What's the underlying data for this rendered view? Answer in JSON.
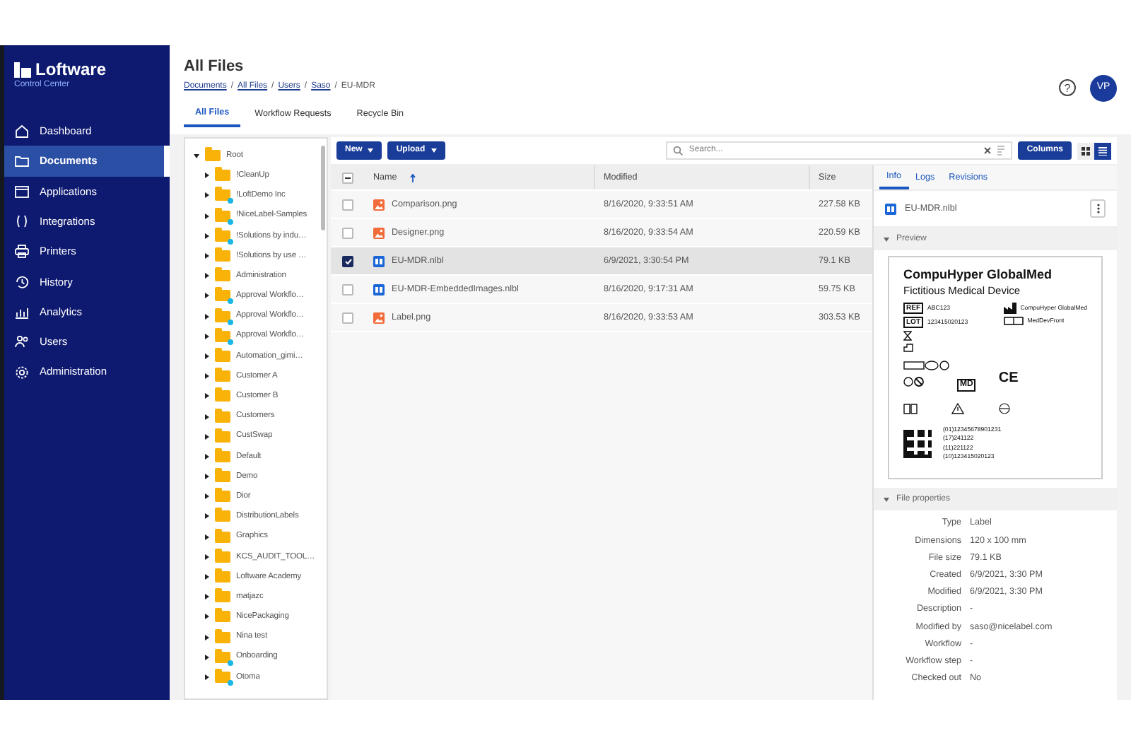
{
  "sidebar": {
    "logo": {
      "name": "Loftware",
      "subtitle": "Control Center"
    },
    "items": [
      {
        "label": "Dashboard",
        "selected": false
      },
      {
        "label": "Documents",
        "selected": true
      },
      {
        "label": "Applications",
        "selected": false
      },
      {
        "label": "Integrations",
        "selected": false
      },
      {
        "label": "Printers",
        "selected": false
      },
      {
        "label": "History",
        "selected": false
      },
      {
        "label": "Analytics",
        "selected": false
      },
      {
        "label": "Users",
        "selected": false
      },
      {
        "label": "Administration",
        "selected": false
      }
    ]
  },
  "header": {
    "title": "All Files",
    "breadcrumb": [
      {
        "label": "Documents",
        "current": false
      },
      {
        "label": "All Files",
        "current": false
      },
      {
        "label": "Users",
        "current": false
      },
      {
        "label": "Saso",
        "current": false
      },
      {
        "label": "EU-MDR",
        "current": true
      }
    ],
    "breadcrumb_separators": [
      "/",
      "/",
      "/",
      "/"
    ],
    "tabs": [
      {
        "label": "All Files",
        "selected": true
      },
      {
        "label": "Workflow Requests",
        "selected": false
      },
      {
        "label": "Recycle Bin",
        "selected": false
      }
    ],
    "help": "?",
    "avatar": "VP"
  },
  "tree": {
    "label": "Root",
    "expanded": true,
    "shared": false,
    "children": [
      {
        "label": "!CleanUp",
        "expanded": false,
        "shared": false
      },
      {
        "label": "!LoftDemo Inc",
        "expanded": false,
        "shared": true
      },
      {
        "label": "!NiceLabel-Samples",
        "expanded": false,
        "shared": true
      },
      {
        "label": "!Solutions by indu…",
        "expanded": false,
        "shared": true
      },
      {
        "label": "!Solutions by use …",
        "expanded": false,
        "shared": false
      },
      {
        "label": "Administration",
        "expanded": false,
        "shared": false
      },
      {
        "label": "Approval Workflo…",
        "expanded": false,
        "shared": true
      },
      {
        "label": "Approval Workflo…",
        "expanded": false,
        "shared": true
      },
      {
        "label": "Approval Workflo…",
        "expanded": false,
        "shared": true
      },
      {
        "label": "Automation_gimi…",
        "expanded": false,
        "shared": false
      },
      {
        "label": "Customer A",
        "expanded": false,
        "shared": false
      },
      {
        "label": "Customer B",
        "expanded": false,
        "shared": false
      },
      {
        "label": "Customers",
        "expanded": false,
        "shared": false
      },
      {
        "label": "CustSwap",
        "expanded": false,
        "shared": false
      },
      {
        "label": "Default",
        "expanded": false,
        "shared": false
      },
      {
        "label": "Demo",
        "expanded": false,
        "shared": false
      },
      {
        "label": "Dior",
        "expanded": false,
        "shared": false
      },
      {
        "label": "DistributionLabels",
        "expanded": false,
        "shared": false
      },
      {
        "label": "Graphics",
        "expanded": false,
        "shared": false
      },
      {
        "label": "KCS_AUDIT_TOOL…",
        "expanded": false,
        "shared": false
      },
      {
        "label": "Loftware Academy",
        "expanded": false,
        "shared": false
      },
      {
        "label": "matjazc",
        "expanded": false,
        "shared": false
      },
      {
        "label": "NicePackaging",
        "expanded": false,
        "shared": false
      },
      {
        "label": "Nina test",
        "expanded": false,
        "shared": false
      },
      {
        "label": "Onboarding",
        "expanded": false,
        "shared": true
      },
      {
        "label": "Otoma",
        "expanded": false,
        "shared": true
      }
    ]
  },
  "toolbar": {
    "buttons": [
      "New",
      "Upload"
    ],
    "search": {
      "placeholder": "Search..."
    },
    "columns_button": "Columns",
    "views": [
      {
        "kind": "grid",
        "selected": false
      },
      {
        "kind": "list",
        "selected": true
      }
    ]
  },
  "table": {
    "select_all": {
      "indeterminate": true
    },
    "columns": [
      {
        "label": "Name",
        "sorted": true
      },
      {
        "label": "Modified",
        "sorted": false
      },
      {
        "label": "Size",
        "sorted": false
      }
    ],
    "rows": [
      {
        "kind": "image",
        "name": "Comparison.png",
        "modified": "8/16/2020, 9:33:51 AM",
        "size": "227.58 KB",
        "checked": false,
        "selected": false
      },
      {
        "kind": "image",
        "name": "Designer.png",
        "modified": "8/16/2020, 9:33:54 AM",
        "size": "220.59 KB",
        "checked": false,
        "selected": false
      },
      {
        "kind": "label",
        "name": "EU-MDR.nlbl",
        "modified": "6/9/2021, 3:30:54 PM",
        "size": "79.1 KB",
        "checked": true,
        "selected": true
      },
      {
        "kind": "label",
        "name": "EU-MDR-EmbeddedImages.nlbl",
        "modified": "8/16/2020, 9:17:31 AM",
        "size": "59.75 KB",
        "checked": false,
        "selected": false
      },
      {
        "kind": "image",
        "name": "Label.png",
        "modified": "8/16/2020, 9:33:53 AM",
        "size": "303.53 KB",
        "checked": false,
        "selected": false
      }
    ]
  },
  "details": {
    "tabs": [
      {
        "label": "Info",
        "selected": true
      },
      {
        "label": "Logs",
        "selected": false
      },
      {
        "label": "Revisions",
        "selected": false
      }
    ],
    "file": {
      "kind": "label",
      "name": "EU-MDR.nlbl"
    },
    "preview": {
      "heading": "Preview",
      "expanded": true,
      "label": {
        "title": "CompuHyper GlobalMed",
        "subtitle": "Fictitious Medical Device",
        "ref_tag": "REF",
        "ref": "ABC123",
        "lot_tag": "LOT",
        "lot": "123415020123",
        "maker": "CompuHyper GlobalMed",
        "front": "MedDevFront",
        "md": "MD",
        "ce": "CE",
        "codes": [
          "(01)12345678901231",
          "(17)241122",
          "(11)221122",
          "(10)123415020123"
        ]
      }
    },
    "properties": {
      "heading": "File properties",
      "expanded": true,
      "rows": [
        {
          "key": "Type",
          "value": "Label"
        },
        {
          "key": "Dimensions",
          "value": "120 x 100 mm"
        },
        {
          "key": "File size",
          "value": "79.1 KB"
        },
        {
          "key": "Created",
          "value": "6/9/2021, 3:30 PM"
        },
        {
          "key": "Modified",
          "value": "6/9/2021, 3:30 PM"
        },
        {
          "key": "Description",
          "value": "-"
        },
        {
          "key": "Modified by",
          "value": "saso@nicelabel.com"
        },
        {
          "key": "Workflow",
          "value": "-"
        },
        {
          "key": "Workflow step",
          "value": "-"
        },
        {
          "key": "Checked out",
          "value": "No"
        }
      ]
    }
  }
}
